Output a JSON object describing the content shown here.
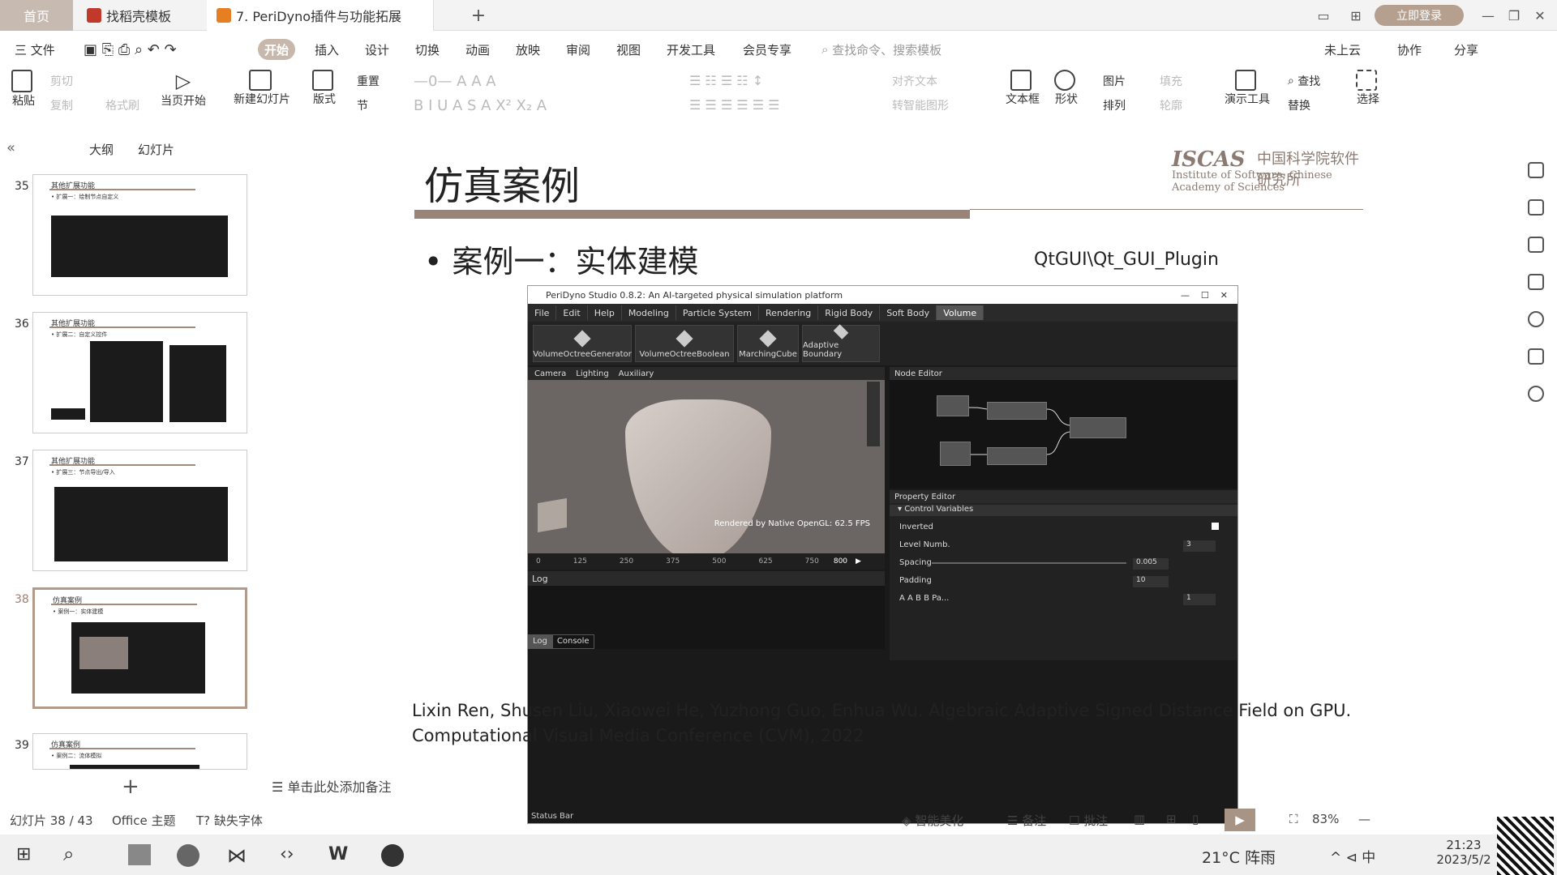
{
  "tabs": {
    "home": "首页",
    "template": "找稻壳模板",
    "doc": "7. PeriDyno插件与功能拓展",
    "login": "立即登录"
  },
  "menu": {
    "file": "三 文件",
    "items": [
      "开始",
      "插入",
      "设计",
      "切换",
      "动画",
      "放映",
      "审阅",
      "视图",
      "开发工具",
      "会员专享"
    ],
    "search": "查找命令、搜索模板",
    "cloud": "未上云",
    "collab": "协作",
    "share": "分享"
  },
  "ribbon": {
    "paste": "粘贴",
    "cut": "剪切",
    "copy": "复制",
    "format": "格式刷",
    "start_show": "当页开始",
    "new_slide": "新建幻灯片",
    "layout": "版式",
    "reset": "重置",
    "section": "节",
    "font_size": "0",
    "align_text": "对齐文本",
    "convert_art": "转智能图形",
    "textbox": "文本框",
    "shape": "形状",
    "image": "图片",
    "fill": "填充",
    "arrange": "排列",
    "outline": "轮廓",
    "present_tool": "演示工具",
    "find": "查找",
    "replace": "替换",
    "select": "选择"
  },
  "leftpanel": {
    "outline": "大纲",
    "slides": "幻灯片",
    "thumbs": [
      {
        "num": "35",
        "title": "其他扩展功能",
        "sub": "• 扩展一：绘制节点自定义"
      },
      {
        "num": "36",
        "title": "其他扩展功能",
        "sub": "• 扩展二：自定义控件"
      },
      {
        "num": "37",
        "title": "其他扩展功能",
        "sub": "• 扩展三：节点导出/导入"
      },
      {
        "num": "38",
        "title": "仿真案例",
        "sub": "• 案例一：实体建模"
      },
      {
        "num": "39",
        "title": "仿真案例",
        "sub": "• 案例二：流体模拟"
      }
    ]
  },
  "slide": {
    "title": "仿真案例",
    "logo_main": "ISCAS",
    "logo_cn": "中国科学院软件研究所",
    "logo_en": "Institute of Software, Chinese Academy of Sciences",
    "bullet": "• 案例一：实体建模",
    "path": "QtGUI\\Qt_GUI_Plugin",
    "citation_line1": "Lixin Ren, Shusen Liu, Xiaowei He, Yuzhong Guo, Enhua Wu. Algebraic Adaptive Signed Distance Field on GPU.",
    "citation_line2": "Computational Visual Media Conference (CVM), 2022"
  },
  "app": {
    "title": "PeriDyno Studio 0.8.2:  An AI-targeted physical simulation platform",
    "menus": [
      "File",
      "Edit",
      "Help",
      "Modeling",
      "Particle System",
      "Rendering",
      "Rigid Body",
      "Soft Body",
      "Volume"
    ],
    "tools": [
      "VolumeOctreeGenerator",
      "VolumeOctreeBoolean",
      "MarchingCube",
      "Adaptive Boundary"
    ],
    "view_tabs": [
      "Camera",
      "Lighting",
      "Auxiliary"
    ],
    "render_info": "Rendered by Native OpenGL: 62.5 FPS",
    "timeline_end": "800",
    "timeline_ticks": [
      "0",
      "125",
      "250",
      "375",
      "500",
      "625",
      "750"
    ],
    "log_title": "Log",
    "log_tabs": [
      "Log",
      "Console"
    ],
    "status": "Status Bar",
    "node_editor": "Node Editor",
    "property_editor": "Property Editor",
    "control_vars": "Control Variables",
    "props": [
      {
        "label": "Inverted",
        "value": ""
      },
      {
        "label": "Level Numb.",
        "value": "3"
      },
      {
        "label": "Spacing",
        "value": "0.005"
      },
      {
        "label": "Padding",
        "value": "10"
      },
      {
        "label": "A A B B Pa...",
        "value": "1"
      }
    ]
  },
  "bottom": {
    "notes": "单击此处添加备注",
    "slide_count": "幻灯片 38 / 43",
    "theme": "Office 主题",
    "missing_font": "缺失字体",
    "beautify": "智能美化",
    "remarks": "备注",
    "comments": "批注",
    "zoom": "83%"
  },
  "taskbar": {
    "weather": "21°C 阵雨",
    "time": "21:23",
    "date": "2023/5/2",
    "ime": "中"
  }
}
